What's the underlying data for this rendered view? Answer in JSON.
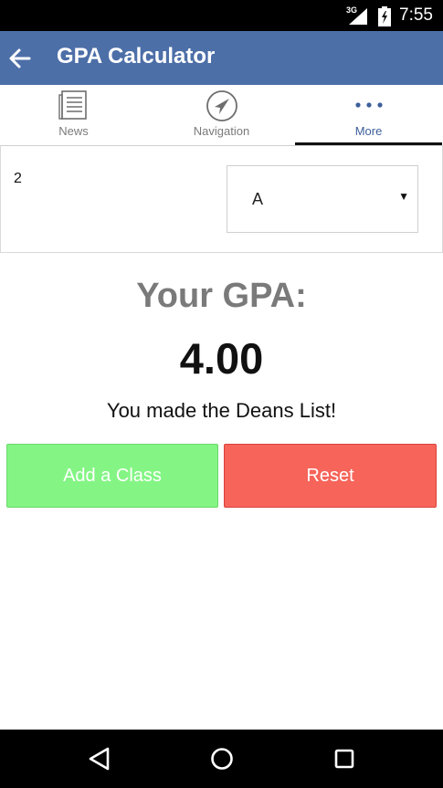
{
  "status_bar": {
    "network": "3G",
    "time": "7:55"
  },
  "app_bar": {
    "title": "GPA Calculator"
  },
  "tabs": [
    {
      "label": "News",
      "icon": "news-icon"
    },
    {
      "label": "Navigation",
      "icon": "navigation-icon"
    },
    {
      "label": "More",
      "icon": "more-dots-icon",
      "active": true
    }
  ],
  "class_row": {
    "credits": "2",
    "grade": "A"
  },
  "result": {
    "label": "Your GPA:",
    "value": "4.00",
    "message": "You made the Deans List!"
  },
  "buttons": {
    "add_label": "Add a Class",
    "reset_label": "Reset"
  },
  "colors": {
    "app_bar": "#4d6fa8",
    "add_button": "#84f584",
    "reset_button": "#f6645a",
    "active_tab": "#3d5f9a"
  }
}
